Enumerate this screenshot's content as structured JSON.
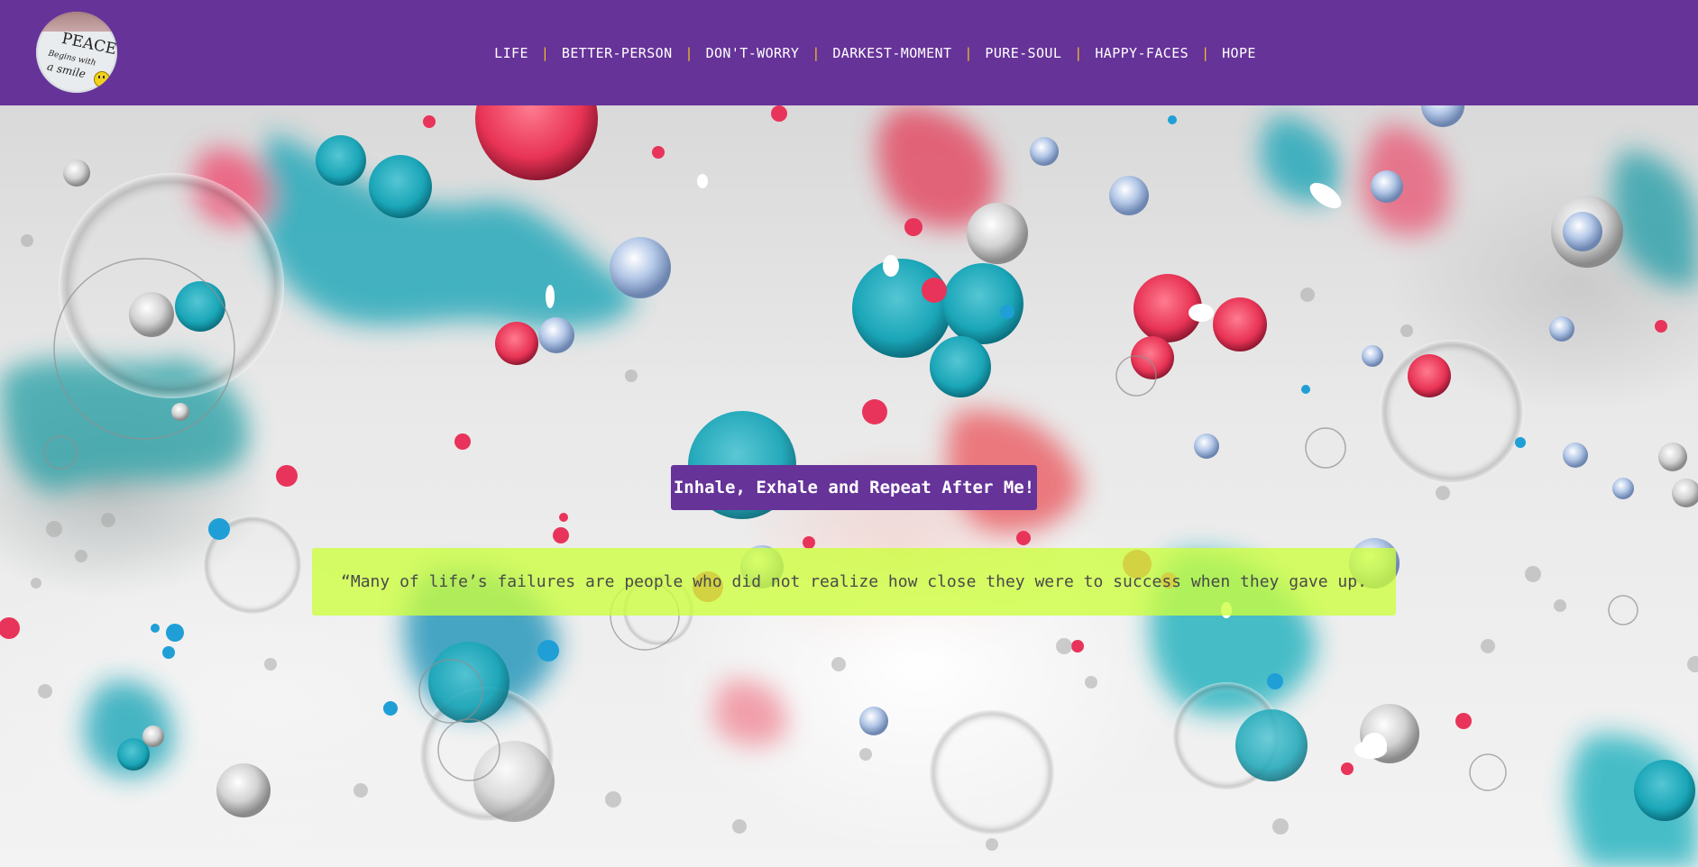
{
  "header": {
    "logo": {
      "line1": "PEACE",
      "line2": "Begins with",
      "line3": "a smile"
    },
    "nav": [
      {
        "label": "LIFE"
      },
      {
        "label": "BETTER-PERSON"
      },
      {
        "label": "DON'T-WORRY"
      },
      {
        "label": "DARKEST-MOMENT"
      },
      {
        "label": "PURE-SOUL"
      },
      {
        "label": "HAPPY-FACES"
      },
      {
        "label": "HOPE"
      }
    ],
    "separator": "|"
  },
  "hero": {
    "tagline": "Inhale, Exhale and Repeat After Me!",
    "quote": "“Many of life’s failures are people who did not realize how close they were to success when they gave up."
  },
  "colors": {
    "brand": "#663399",
    "separator": "#f0c020",
    "quote_highlight": "#cdff3c"
  }
}
